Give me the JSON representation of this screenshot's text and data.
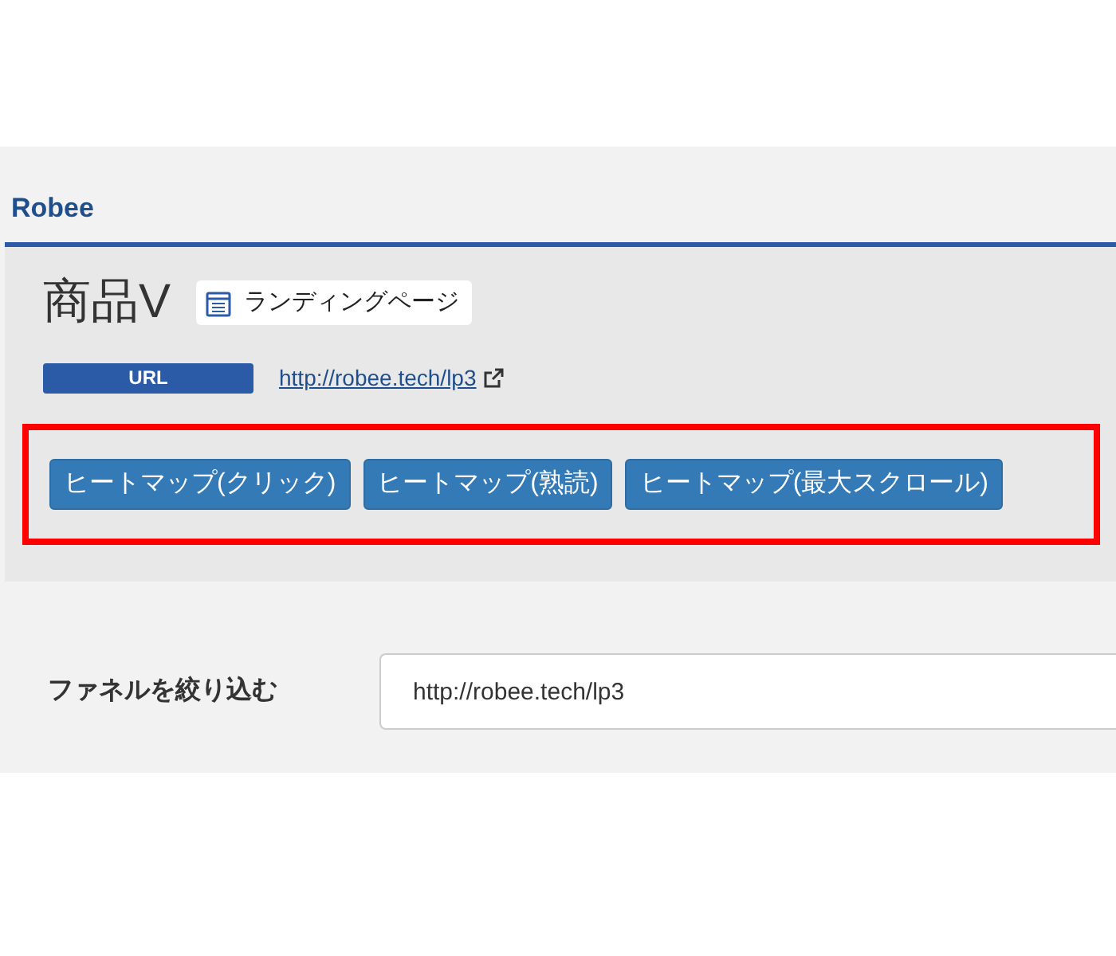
{
  "app_title": "Robee",
  "product": {
    "name": "商品V",
    "tag": "ランディングページ"
  },
  "url": {
    "label": "URL",
    "link": "http://robee.tech/lp3"
  },
  "heatmap_buttons": {
    "highlighted": true,
    "buttons": [
      {
        "label": "ヒートマップ(クリック)"
      },
      {
        "label": "ヒートマップ(熟読)"
      },
      {
        "label": "ヒートマップ(最大スクロール)"
      }
    ]
  },
  "funnel_filter": {
    "label": "ファネルを絞り込む",
    "value": "http://robee.tech/lp3"
  }
}
